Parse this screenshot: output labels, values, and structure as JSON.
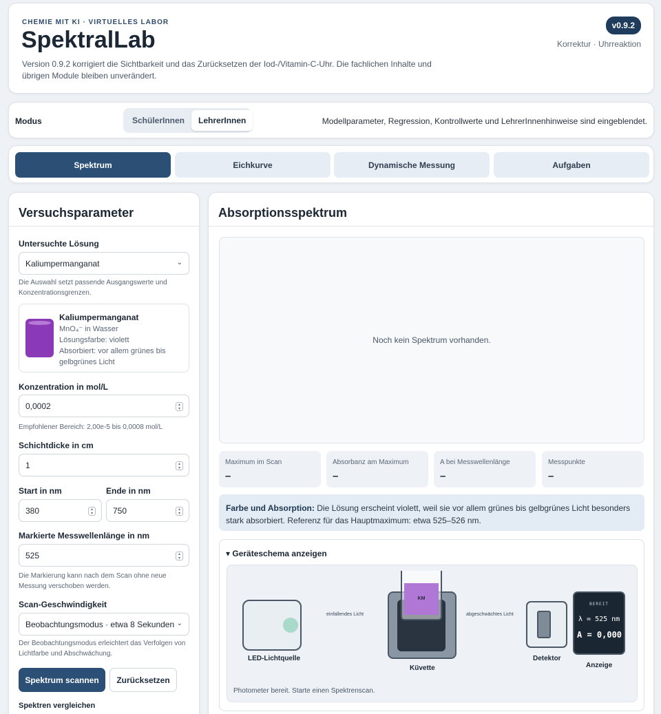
{
  "header": {
    "eyebrow": "CHEMIE MIT KI · VIRTUELLES LABOR",
    "title": "SpektralLab",
    "description": "Version 0.9.2 korrigiert die Sichtbarkeit und das Zurücksetzen der Iod-/Vitamin-C-Uhr. Die fachlichen Inhalte und übrigen Module bleiben unverändert.",
    "version": "v0.9.2",
    "version_note": "Korrektur · Uhrreaktion"
  },
  "mode": {
    "label": "Modus",
    "options": [
      "SchülerInnen",
      "LehrerInnen"
    ],
    "active": "LehrerInnen",
    "note": "Modellparameter, Regression, Kontrollwerte und LehrerInnenhinweise sind eingeblendet."
  },
  "tabs": [
    {
      "label": "Spektrum",
      "active": true
    },
    {
      "label": "Eichkurve",
      "active": false
    },
    {
      "label": "Dynamische Messung",
      "active": false
    },
    {
      "label": "Aufgaben",
      "active": false
    }
  ],
  "params": {
    "title": "Versuchsparameter",
    "solution_label": "Untersuchte Lösung",
    "solution_value": "Kaliumpermanganat",
    "solution_hint": "Die Auswahl setzt passende Ausgangswerte und Konzentrationsgrenzen.",
    "substance": {
      "name": "Kaliumpermanganat",
      "formula": "MnO₄⁻ in Wasser",
      "color": "Lösungsfarbe: violett",
      "absorbs": "Absorbiert: vor allem grünes bis gelbgrünes Licht",
      "vial_color": "#8b3ab7"
    },
    "conc_label": "Konzentration in mol/L",
    "conc_value": "0,0002",
    "conc_hint": "Empfohlener Bereich: 2,00e-5 bis 0,0008 mol/L",
    "thick_label": "Schichtdicke in cm",
    "thick_value": "1",
    "start_label": "Start in nm",
    "start_value": "380",
    "end_label": "Ende in nm",
    "end_value": "750",
    "mark_label": "Markierte Messwellenlänge in nm",
    "mark_value": "525",
    "mark_hint": "Die Markierung kann nach dem Scan ohne neue Messung verschoben werden.",
    "speed_label": "Scan-Geschwindigkeit",
    "speed_value": "Beobachtungsmodus · etwa 8 Sekunden",
    "speed_hint": "Der Beobachtungsmodus erleichtert das Verfolgen von Lichtfarbe und Abschwächung.",
    "scan_button": "Spektrum scannen",
    "reset_button": "Zurücksetzen",
    "compare_label": "Spektren vergleichen"
  },
  "spectrum": {
    "title": "Absorptionsspektrum",
    "empty": "Noch kein Spektrum vorhanden.",
    "stats": [
      {
        "label": "Maximum im Scan",
        "value": "–"
      },
      {
        "label": "Absorbanz am Maximum",
        "value": "–"
      },
      {
        "label": "A bei Messwellenlänge",
        "value": "–"
      },
      {
        "label": "Messpunkte",
        "value": "–"
      }
    ],
    "info_bold": "Farbe und Absorption:",
    "info_text": "Die Lösung erscheint violett, weil sie vor allem grünes bis gelbgrünes Licht besonders stark absorbiert. Referenz für das Hauptmaximum: etwa 525–526 nm.",
    "schema_summary": "▾ Geräteschema anzeigen",
    "schema": {
      "led": "LED-Lichtquelle",
      "incoming": "einfallendes Licht",
      "cuvette": "Küvette",
      "cuvette_tag": "KM",
      "attenuated": "abgeschwächtes Licht",
      "detector": "Detektor",
      "display": "Anzeige",
      "display_status": "BEREIT",
      "display_lambda": "λ = 525 nm",
      "display_a": "A = 0,000",
      "status": "Photometer bereit. Starte einen Spektrenscan."
    }
  },
  "colors": {
    "primary": "#2b4f75",
    "badge": "#1f3c5c",
    "solution": "#8b3ab7"
  }
}
